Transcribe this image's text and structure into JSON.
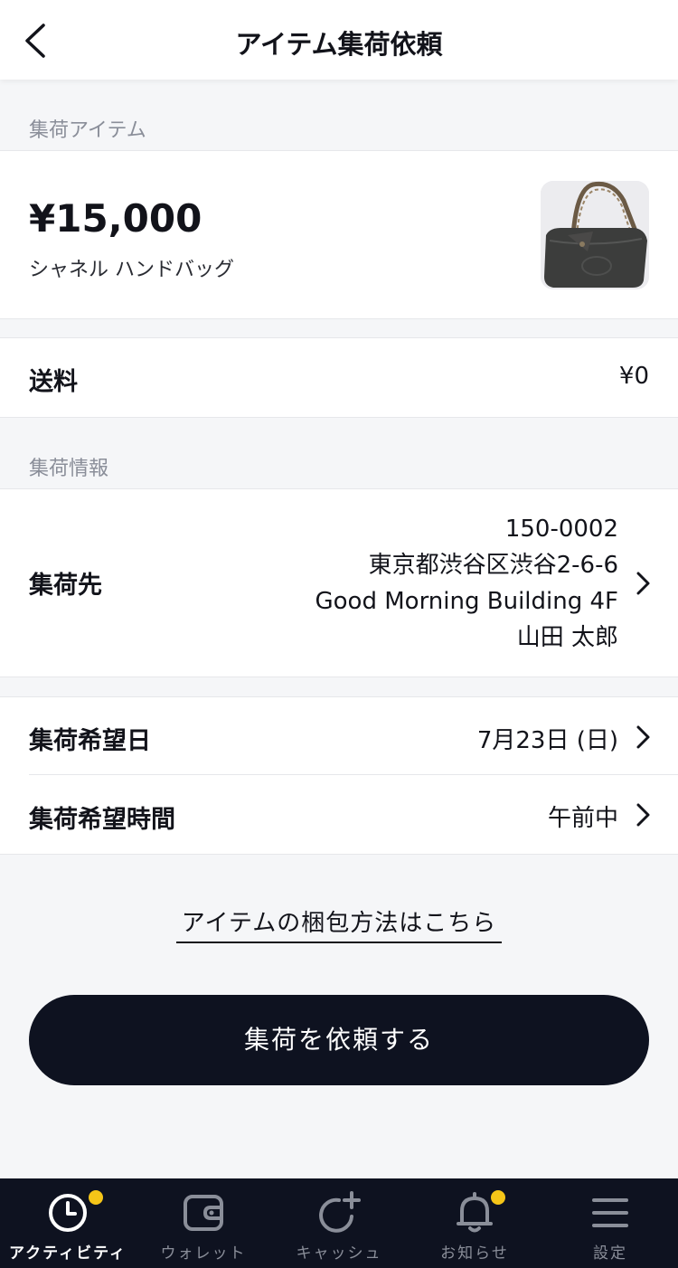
{
  "header": {
    "title": "アイテム集荷依頼"
  },
  "item_section": {
    "label": "集荷アイテム",
    "price": "¥15,000",
    "name": "シャネル ハンドバッグ"
  },
  "shipping": {
    "label": "送料",
    "value": "¥0"
  },
  "pickup_section": {
    "label": "集荷情報",
    "address_label": "集荷先",
    "address_lines": [
      "150-0002",
      "東京都渋谷区渋谷2-6-6",
      "Good Morning Building 4F",
      "山田 太郎"
    ],
    "date_label": "集荷希望日",
    "date_value": "7月23日 (日)",
    "time_label": "集荷希望時間",
    "time_value": "午前中"
  },
  "packing_link": "アイテムの梱包方法はこちら",
  "submit_button": "集荷を依頼する",
  "tabbar": {
    "tabs": [
      {
        "label": "アクティビティ",
        "icon": "clock-icon",
        "active": true,
        "badge": true
      },
      {
        "label": "ウォレット",
        "icon": "wallet-icon",
        "active": false,
        "badge": false
      },
      {
        "label": "キャッシュ",
        "icon": "cash-add-icon",
        "active": false,
        "badge": false
      },
      {
        "label": "お知らせ",
        "icon": "bell-icon",
        "active": false,
        "badge": true
      },
      {
        "label": "設定",
        "icon": "menu-icon",
        "active": false,
        "badge": false
      }
    ]
  },
  "colors": {
    "accent_dark": "#0e1220",
    "badge_yellow": "#f5c518",
    "background": "#f5f6f8"
  }
}
